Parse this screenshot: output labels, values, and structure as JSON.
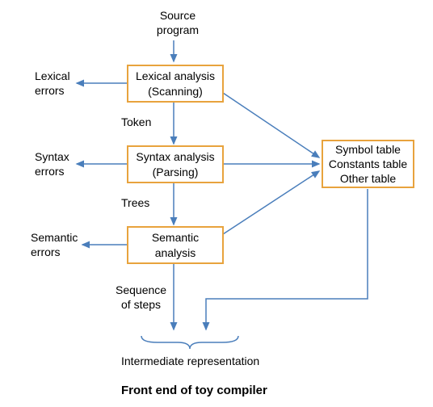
{
  "diagram": {
    "title": "Front end of toy compiler",
    "input": {
      "line1": "Source",
      "line2": "program"
    },
    "stages": {
      "lexical": {
        "line1": "Lexical analysis",
        "line2": "(Scanning)"
      },
      "syntax": {
        "line1": "Syntax analysis",
        "line2": "(Parsing)"
      },
      "semantic": {
        "line1": "Semantic",
        "line2": "analysis"
      }
    },
    "side_outputs": {
      "lexical_errors": {
        "line1": "Lexical",
        "line2": "errors"
      },
      "syntax_errors": {
        "line1": "Syntax",
        "line2": "errors"
      },
      "semantic_errors": {
        "line1": "Semantic",
        "line2": "errors"
      }
    },
    "intermediate_labels": {
      "token": "Token",
      "trees": "Trees",
      "sequence": {
        "line1": "Sequence",
        "line2": "of steps"
      }
    },
    "tables": {
      "line1": "Symbol table",
      "line2": "Constants table",
      "line3": "Other table"
    },
    "output": "Intermediate representation"
  }
}
